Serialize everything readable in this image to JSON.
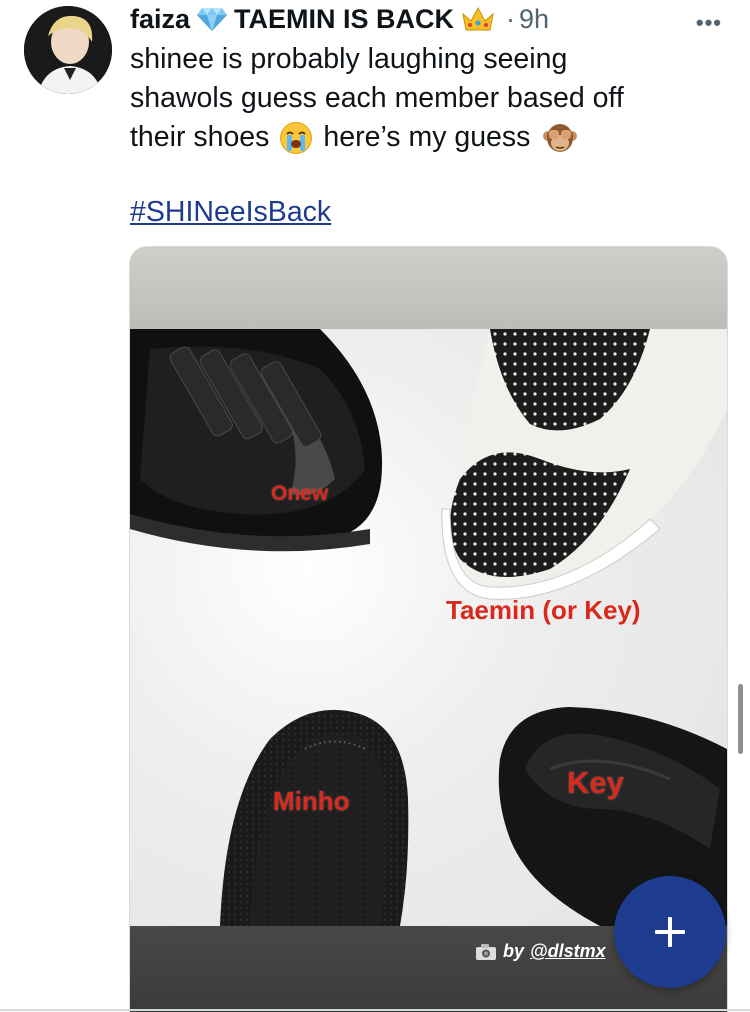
{
  "tweet": {
    "author_name": "faiza",
    "author_badge_icon": "gem-icon",
    "display_tag": "TAEMIN IS BACK",
    "display_tag_icon": "crown-icon",
    "separator": "·",
    "time": "9h",
    "more_label": "•••",
    "text_lines": [
      "shinee is probably laughing seeing",
      "shawols guess each member based off",
      "their shoes",
      "here’s my guess"
    ],
    "emoji_after_shoes": "loudly-crying-face-icon",
    "emoji_after_guess": "see-no-evil-monkey-icon",
    "hashtag": "#SHINeeIsBack"
  },
  "media": {
    "labels": {
      "onew": "Onew",
      "taemin": "Taemin (or Key)",
      "minho": "Minho",
      "key": "Key"
    },
    "credit_prefix": "by",
    "credit_handle": "@dlstmx",
    "credit_icon": "camera-icon"
  },
  "compose_button": "plus-icon",
  "colors": {
    "accent": "#1d3c8f",
    "label_red": "#d9291c",
    "muted": "#536471"
  }
}
